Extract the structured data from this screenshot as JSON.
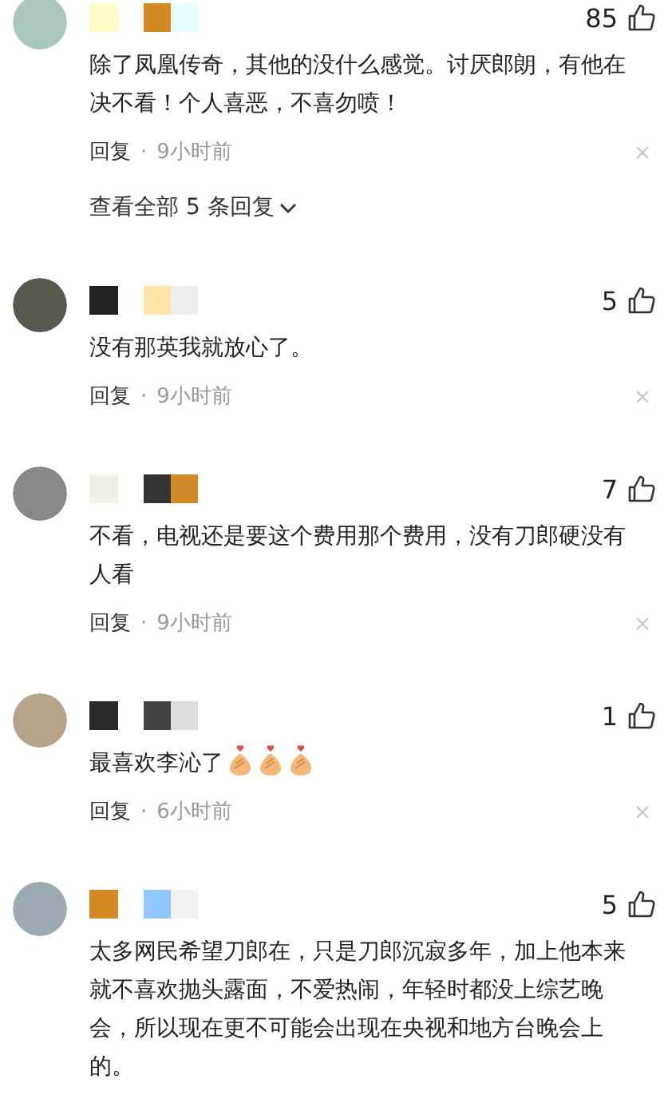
{
  "comments": [
    {
      "likes": "85",
      "text": "除了凤凰传奇，其他的没什么感觉。讨厌郎朗，有他在决不看！个人喜恶，不喜勿喷！",
      "reply": "回复",
      "dot": "·",
      "time": "9小时前",
      "view_replies": "查看全部 5 条回复"
    },
    {
      "likes": "5",
      "text": "没有那英我就放心了。",
      "reply": "回复",
      "dot": "·",
      "time": "9小时前"
    },
    {
      "likes": "7",
      "text": "不看，电视还是要这个费用那个费用，没有刀郎硬没有人看",
      "reply": "回复",
      "dot": "·",
      "time": "9小时前"
    },
    {
      "likes": "1",
      "text": "最喜欢李沁了",
      "emojis": [
        {
          "kind": "finger-heart"
        },
        {
          "kind": "finger-heart"
        },
        {
          "kind": "finger-heart"
        }
      ],
      "reply": "回复",
      "dot": "·",
      "time": "6小时前"
    },
    {
      "likes": "5",
      "text": "太多网民希望刀郎在，只是刀郎沉寂多年，加上他本来就不喜欢抛头露面，不爱热闹，年轻时都没上综艺晚会，所以现在更不可能会出现在央视和地方台晚会上的。"
    }
  ]
}
